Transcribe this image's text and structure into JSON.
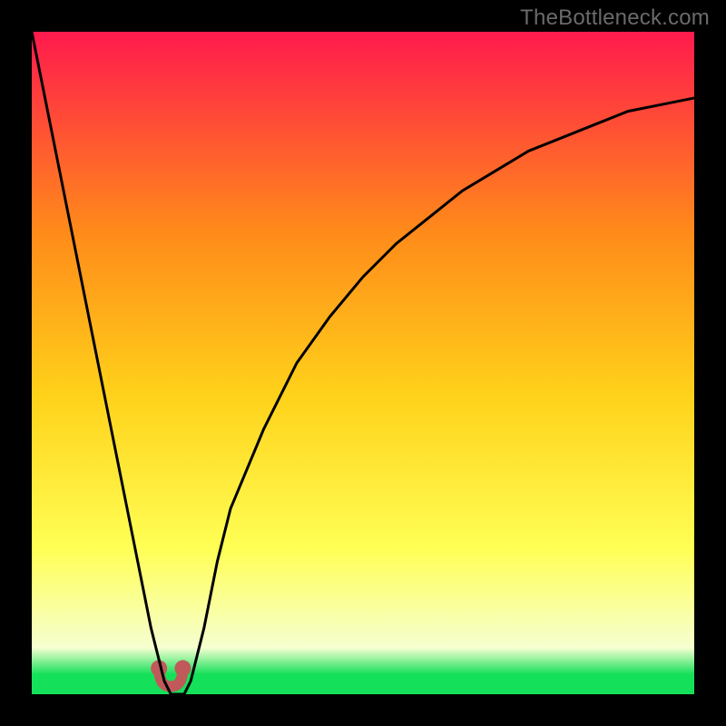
{
  "watermark": "TheBottleneck.com",
  "colors": {
    "bg_black": "#000000",
    "grad_top": "#ff1a4d",
    "grad_mid_upper": "#ff8a1a",
    "grad_mid": "#ffd21a",
    "grad_lower": "#ffff55",
    "grad_pale": "#f6ffd0",
    "grad_green": "#15e05a",
    "curve": "#000000",
    "bumps": "#c05a5a"
  },
  "chart_data": {
    "type": "line",
    "title": "",
    "xlabel": "",
    "ylabel": "",
    "xlim": [
      0,
      100
    ],
    "ylim": [
      0,
      100
    ],
    "x": [
      0,
      2,
      4,
      6,
      8,
      10,
      12,
      14,
      16,
      18,
      20,
      21,
      22,
      23,
      24,
      26,
      28,
      30,
      35,
      40,
      45,
      50,
      55,
      60,
      65,
      70,
      75,
      80,
      85,
      90,
      95,
      100
    ],
    "values": [
      100,
      90,
      80,
      70,
      60,
      50,
      40,
      30,
      20,
      10,
      2,
      0,
      0,
      0,
      2,
      10,
      20,
      28,
      40,
      50,
      57,
      63,
      68,
      72,
      76,
      79,
      82,
      84,
      86,
      88,
      89,
      90
    ],
    "series": [
      {
        "name": "curve",
        "note": "V-shaped bottleneck curve. Minimum near x≈21. Right branch asymptotes around y≈90."
      }
    ],
    "annotations": [
      {
        "name": "trough-bumps",
        "x_range": [
          18,
          24
        ],
        "y": 2,
        "color": "#c05a5a"
      }
    ],
    "gradient_stops": [
      {
        "offset": 0.0,
        "color": "#ff1a4d"
      },
      {
        "offset": 0.3,
        "color": "#ff8a1a"
      },
      {
        "offset": 0.55,
        "color": "#ffd21a"
      },
      {
        "offset": 0.78,
        "color": "#ffff55"
      },
      {
        "offset": 0.93,
        "color": "#f6ffd0"
      },
      {
        "offset": 0.97,
        "color": "#15e05a"
      },
      {
        "offset": 1.0,
        "color": "#15e05a"
      }
    ]
  }
}
